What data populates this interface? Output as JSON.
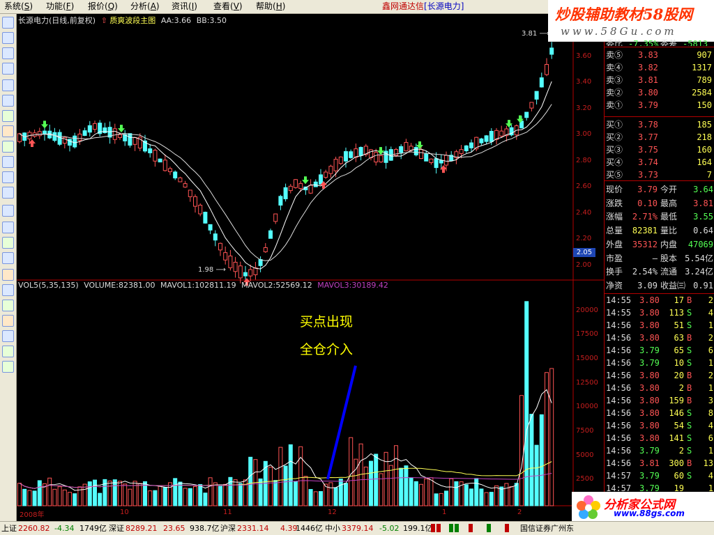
{
  "menu": [
    {
      "label": "系统",
      "hotkey": "S"
    },
    {
      "label": "功能",
      "hotkey": "F"
    },
    {
      "label": "报价",
      "hotkey": "Q"
    },
    {
      "label": "分析",
      "hotkey": "A"
    },
    {
      "label": "资讯",
      "hotkey": "I"
    },
    {
      "label": "查看",
      "hotkey": "V"
    },
    {
      "label": "帮助",
      "hotkey": "H"
    }
  ],
  "window_title": {
    "app": "鑫网通达信",
    "stock": "[长源电力]"
  },
  "watermark": {
    "line1": "炒股辅助教材58股网",
    "line2": "www.58Gu.com"
  },
  "chart": {
    "title": "长源电力(日线,前复权)",
    "indicator": "质爽波段主图",
    "param_aa": "AA:3.66",
    "param_bb": "BB:3.50",
    "price_axis": [
      "3.60",
      "3.40",
      "3.20",
      "3.00",
      "2.80",
      "2.60",
      "2.40",
      "2.20",
      "2.00"
    ],
    "last_price_tag": "2.05",
    "high_tag": "3.81",
    "low_tag": "1.98",
    "volume_info": {
      "vol": "VOL5(5,35,135)",
      "volume": "VOLUME:82381.00",
      "mavol1": "MAVOL1:102811.19",
      "mavol2": "MAVOL2:52569.12",
      "mavol3": "MAVOL3:30189.42"
    },
    "volume_axis": [
      "20000",
      "17500",
      "15000",
      "12500",
      "10000",
      "7500",
      "5000",
      "2500"
    ],
    "annotation_line1": "买点出现",
    "annotation_line2": "全仓介入",
    "x_axis": [
      "2008年",
      "10",
      "11",
      "12",
      "1",
      "2"
    ],
    "colors": {
      "up": "#ff5454",
      "down": "#54ffff",
      "ma1": "#ffffff",
      "ma2": "#ffff54",
      "vol_ma3": "#c040c0",
      "annot_line": "#0000ff"
    }
  },
  "quote": {
    "top_partial": {
      "l1": "委比",
      "v1": "-7.35%",
      "l2": "委差",
      "v2": "-5813"
    },
    "asks": [
      {
        "label": "卖⑤",
        "price": "3.83",
        "vol": "907"
      },
      {
        "label": "卖④",
        "price": "3.82",
        "vol": "1317"
      },
      {
        "label": "卖③",
        "price": "3.81",
        "vol": "789"
      },
      {
        "label": "卖②",
        "price": "3.80",
        "vol": "2584"
      },
      {
        "label": "卖①",
        "price": "3.79",
        "vol": "150"
      }
    ],
    "bids": [
      {
        "label": "买①",
        "price": "3.78",
        "vol": "185"
      },
      {
        "label": "买②",
        "price": "3.77",
        "vol": "218"
      },
      {
        "label": "买③",
        "price": "3.75",
        "vol": "160"
      },
      {
        "label": "买④",
        "price": "3.74",
        "vol": "164"
      },
      {
        "label": "买⑤",
        "price": "3.73",
        "vol": "7"
      }
    ],
    "stats": [
      {
        "l1": "现价",
        "v1": "3.79",
        "l2": "今开",
        "v2": "3.64"
      },
      {
        "l1": "涨跌",
        "v1": "0.10",
        "l2": "最高",
        "v2": "3.81"
      },
      {
        "l1": "涨幅",
        "v1": "2.71%",
        "l2": "最低",
        "v2": "3.55"
      },
      {
        "l1": "总量",
        "v1": "82381",
        "l2": "量比",
        "v2": "0.64"
      },
      {
        "l1": "外盘",
        "v1": "35312",
        "l2": "内盘",
        "v2": "47069"
      },
      {
        "l1": "市盈",
        "v1": "—",
        "l2": "股本",
        "v2": "5.54亿"
      },
      {
        "l1": "换手",
        "v1": "2.54%",
        "l2": "流通",
        "v2": "3.24亿"
      },
      {
        "l1": "净资",
        "v1": "3.09",
        "l2": "收益㈢",
        "v2": "0.91"
      }
    ],
    "ticks": [
      {
        "time": "14:55",
        "price": "3.80",
        "vol": "17",
        "side": "B",
        "n": "2"
      },
      {
        "time": "14:55",
        "price": "3.80",
        "vol": "113",
        "side": "S",
        "n": "4"
      },
      {
        "time": "14:56",
        "price": "3.80",
        "vol": "51",
        "side": "S",
        "n": "1"
      },
      {
        "time": "14:56",
        "price": "3.80",
        "vol": "63",
        "side": "B",
        "n": "2"
      },
      {
        "time": "14:56",
        "price": "3.79",
        "vol": "65",
        "side": "S",
        "n": "6"
      },
      {
        "time": "14:56",
        "price": "3.79",
        "vol": "10",
        "side": "S",
        "n": "1"
      },
      {
        "time": "14:56",
        "price": "3.80",
        "vol": "20",
        "side": "B",
        "n": "2"
      },
      {
        "time": "14:56",
        "price": "3.80",
        "vol": "2",
        "side": "B",
        "n": "1"
      },
      {
        "time": "14:56",
        "price": "3.80",
        "vol": "159",
        "side": "B",
        "n": "3"
      },
      {
        "time": "14:56",
        "price": "3.80",
        "vol": "146",
        "side": "S",
        "n": "8"
      },
      {
        "time": "14:56",
        "price": "3.80",
        "vol": "54",
        "side": "S",
        "n": "4"
      },
      {
        "time": "14:56",
        "price": "3.80",
        "vol": "141",
        "side": "S",
        "n": "6"
      },
      {
        "time": "14:56",
        "price": "3.79",
        "vol": "2",
        "side": "S",
        "n": "1"
      },
      {
        "time": "14:56",
        "price": "3.81",
        "vol": "300",
        "side": "B",
        "n": "13"
      },
      {
        "time": "14:57",
        "price": "3.79",
        "vol": "60",
        "side": "S",
        "n": "4"
      },
      {
        "time": "14:57",
        "price": "3.79",
        "vol": "19",
        "side": "",
        "n": "1"
      }
    ]
  },
  "status_bar": {
    "sh": {
      "label": "上证",
      "value": "2260.82",
      "chg": "-4.34",
      "amt": "1749亿"
    },
    "sz": {
      "label": "深证",
      "value": "8289.21",
      "chg": "23.65",
      "amt": "938.7亿"
    },
    "hs": {
      "label": "沪深",
      "value": "2331.14",
      "chg": "4.39",
      "amt": "1446亿"
    },
    "zx": {
      "label": "中小",
      "value": "3379.14",
      "chg": "-5.02",
      "amt": "199.1亿"
    },
    "broker": "国信证券广州东"
  },
  "logo": {
    "line1": "分析家公式网",
    "line2": "www.88gs.com"
  }
}
